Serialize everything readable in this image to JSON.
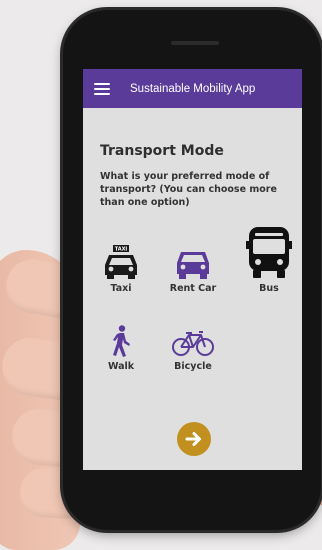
{
  "app": {
    "title": "Sustainable Mobility App",
    "menu_icon": "menu-icon"
  },
  "page": {
    "heading": "Transport Mode",
    "question": "What is your preferred mode of transport? (You can choose more than one option)"
  },
  "options": [
    {
      "label": "Taxi",
      "icon": "taxi-icon",
      "color": "#1a1a1a",
      "selected": false
    },
    {
      "label": "Rent Car",
      "icon": "car-icon",
      "color": "#5a3b9a",
      "selected": false
    },
    {
      "label": "Bus",
      "icon": "bus-icon",
      "color": "#111111",
      "selected": true
    },
    {
      "label": "Walk",
      "icon": "walk-icon",
      "color": "#5a3b9a",
      "selected": false
    },
    {
      "label": "Bicycle",
      "icon": "bicycle-icon",
      "color": "#5a3b9a",
      "selected": false
    }
  ],
  "taxi_sign": "TAXI",
  "next_button": {
    "icon": "arrow-right-icon",
    "color": "#c2901f"
  },
  "colors": {
    "accent": "#5a3b9a",
    "gold": "#c2901f"
  }
}
